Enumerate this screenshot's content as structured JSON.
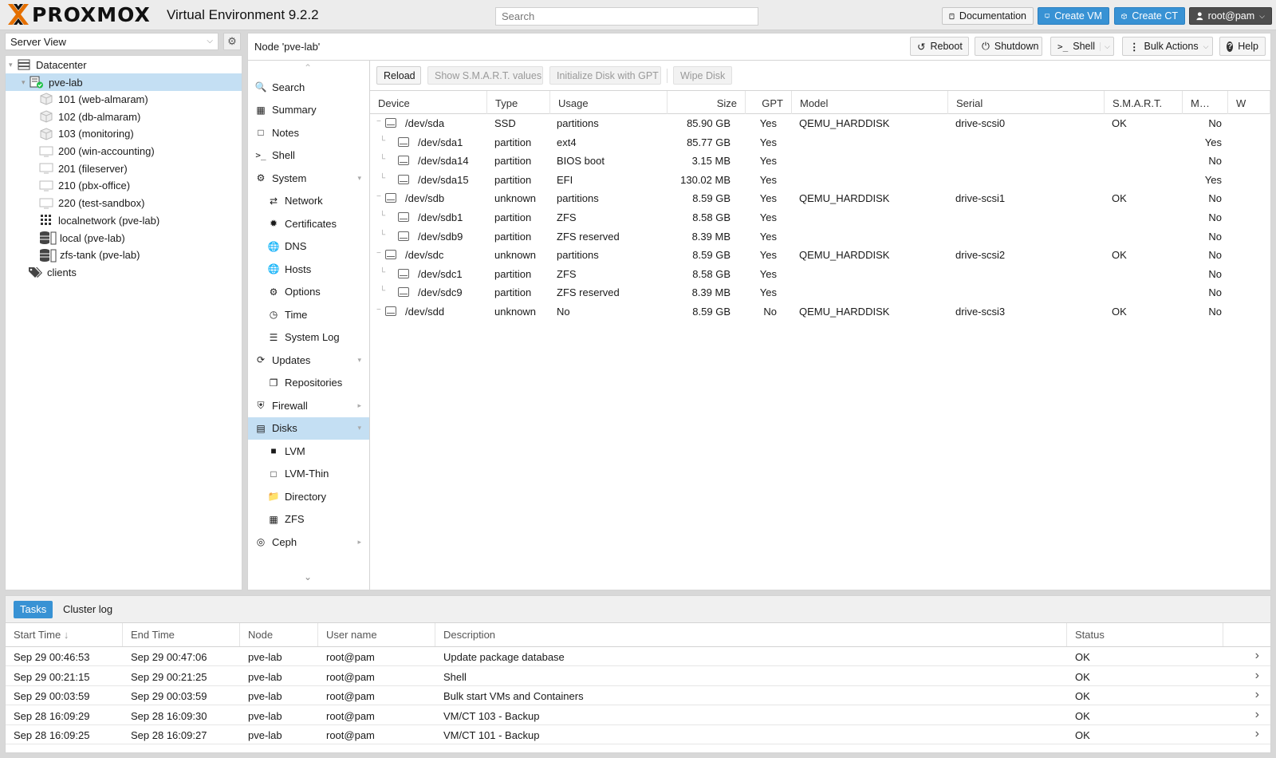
{
  "header": {
    "logo_text": "PROXMOX",
    "product": "Virtual Environment 9.2.2",
    "search_placeholder": "Search",
    "buttons": {
      "documentation": "Documentation",
      "create_vm": "Create VM",
      "create_ct": "Create CT",
      "user": "root@pam"
    }
  },
  "left": {
    "view": "Server View",
    "tree": [
      {
        "label": "Datacenter",
        "icon": "datacenter-icon"
      },
      {
        "label": "pve-lab",
        "icon": "node-online-icon"
      },
      {
        "label": "101 (web-almaram)",
        "icon": "container-icon"
      },
      {
        "label": "102 (db-almaram)",
        "icon": "container-icon"
      },
      {
        "label": "103 (monitoring)",
        "icon": "container-icon"
      },
      {
        "label": "200 (win-accounting)",
        "icon": "vm-icon"
      },
      {
        "label": "201 (fileserver)",
        "icon": "vm-icon"
      },
      {
        "label": "210 (pbx-office)",
        "icon": "vm-icon"
      },
      {
        "label": "220 (test-sandbox)",
        "icon": "vm-icon"
      },
      {
        "label": "localnetwork (pve-lab)",
        "icon": "network-grid-icon"
      },
      {
        "label": "local (pve-lab)",
        "icon": "storage-icon"
      },
      {
        "label": "zfs-tank (pve-lab)",
        "icon": "storage-icon"
      },
      {
        "label": "clients",
        "icon": "tags-icon"
      }
    ]
  },
  "node": {
    "title": "Node 'pve-lab'",
    "buttons": {
      "reboot": "Reboot",
      "shutdown": "Shutdown",
      "shell": "Shell",
      "bulk": "Bulk Actions",
      "help": "Help"
    }
  },
  "nav": [
    {
      "label": "Search",
      "icon": "search-icon"
    },
    {
      "label": "Summary",
      "icon": "book-icon"
    },
    {
      "label": "Notes",
      "icon": "note-icon"
    },
    {
      "label": "Shell",
      "icon": "terminal-icon"
    },
    {
      "label": "System",
      "icon": "cogs-icon"
    },
    {
      "label": "Network",
      "icon": "exchange-icon"
    },
    {
      "label": "Certificates",
      "icon": "certificate-icon"
    },
    {
      "label": "DNS",
      "icon": "globe-icon"
    },
    {
      "label": "Hosts",
      "icon": "globe-icon"
    },
    {
      "label": "Options",
      "icon": "gear-icon"
    },
    {
      "label": "Time",
      "icon": "clock-icon"
    },
    {
      "label": "System Log",
      "icon": "list-icon"
    },
    {
      "label": "Updates",
      "icon": "refresh-icon"
    },
    {
      "label": "Repositories",
      "icon": "files-icon"
    },
    {
      "label": "Firewall",
      "icon": "shield-icon"
    },
    {
      "label": "Disks",
      "icon": "hdd-icon"
    },
    {
      "label": "LVM",
      "icon": "square-icon"
    },
    {
      "label": "LVM-Thin",
      "icon": "square-outline-icon"
    },
    {
      "label": "Directory",
      "icon": "folder-icon"
    },
    {
      "label": "ZFS",
      "icon": "th-large-icon"
    },
    {
      "label": "Ceph",
      "icon": "ceph-icon"
    }
  ],
  "disks": {
    "toolbar": {
      "reload": "Reload",
      "smart": "Show S.M.A.R.T. values",
      "init_gpt": "Initialize Disk with GPT",
      "wipe": "Wipe Disk"
    },
    "columns": [
      "Device",
      "Type",
      "Usage",
      "Size",
      "GPT",
      "Model",
      "Serial",
      "S.M.A.R.T.",
      "M…",
      "W"
    ],
    "rows": [
      {
        "device": "/dev/sda",
        "type": "SSD",
        "usage": "partitions",
        "size": "85.90 GB",
        "gpt": "Yes",
        "model": "QEMU_HARDDISK",
        "serial": "drive-scsi0",
        "smart": "OK",
        "mounted": "No",
        "child": false
      },
      {
        "device": "/dev/sda1",
        "type": "partition",
        "usage": "ext4",
        "size": "85.77 GB",
        "gpt": "Yes",
        "model": "",
        "serial": "",
        "smart": "",
        "mounted": "Yes",
        "child": true
      },
      {
        "device": "/dev/sda14",
        "type": "partition",
        "usage": "BIOS boot",
        "size": "3.15 MB",
        "gpt": "Yes",
        "model": "",
        "serial": "",
        "smart": "",
        "mounted": "No",
        "child": true
      },
      {
        "device": "/dev/sda15",
        "type": "partition",
        "usage": "EFI",
        "size": "130.02 MB",
        "gpt": "Yes",
        "model": "",
        "serial": "",
        "smart": "",
        "mounted": "Yes",
        "child": true
      },
      {
        "device": "/dev/sdb",
        "type": "unknown",
        "usage": "partitions",
        "size": "8.59 GB",
        "gpt": "Yes",
        "model": "QEMU_HARDDISK",
        "serial": "drive-scsi1",
        "smart": "OK",
        "mounted": "No",
        "child": false
      },
      {
        "device": "/dev/sdb1",
        "type": "partition",
        "usage": "ZFS",
        "size": "8.58 GB",
        "gpt": "Yes",
        "model": "",
        "serial": "",
        "smart": "",
        "mounted": "No",
        "child": true
      },
      {
        "device": "/dev/sdb9",
        "type": "partition",
        "usage": "ZFS reserved",
        "size": "8.39 MB",
        "gpt": "Yes",
        "model": "",
        "serial": "",
        "smart": "",
        "mounted": "No",
        "child": true
      },
      {
        "device": "/dev/sdc",
        "type": "unknown",
        "usage": "partitions",
        "size": "8.59 GB",
        "gpt": "Yes",
        "model": "QEMU_HARDDISK",
        "serial": "drive-scsi2",
        "smart": "OK",
        "mounted": "No",
        "child": false
      },
      {
        "device": "/dev/sdc1",
        "type": "partition",
        "usage": "ZFS",
        "size": "8.58 GB",
        "gpt": "Yes",
        "model": "",
        "serial": "",
        "smart": "",
        "mounted": "No",
        "child": true
      },
      {
        "device": "/dev/sdc9",
        "type": "partition",
        "usage": "ZFS reserved",
        "size": "8.39 MB",
        "gpt": "Yes",
        "model": "",
        "serial": "",
        "smart": "",
        "mounted": "No",
        "child": true
      },
      {
        "device": "/dev/sdd",
        "type": "unknown",
        "usage": "No",
        "size": "8.59 GB",
        "gpt": "No",
        "model": "QEMU_HARDDISK",
        "serial": "drive-scsi3",
        "smart": "OK",
        "mounted": "No",
        "child": false
      }
    ]
  },
  "tasks": {
    "tabs": [
      "Tasks",
      "Cluster log"
    ],
    "columns": [
      "Start Time",
      "End Time",
      "Node",
      "User name",
      "Description",
      "Status"
    ],
    "rows": [
      {
        "start": "Sep 29 00:46:53",
        "end": "Sep 29 00:47:06",
        "node": "pve-lab",
        "user": "root@pam",
        "desc": "Update package database",
        "status": "OK"
      },
      {
        "start": "Sep 29 00:21:15",
        "end": "Sep 29 00:21:25",
        "node": "pve-lab",
        "user": "root@pam",
        "desc": "Shell",
        "status": "OK"
      },
      {
        "start": "Sep 29 00:03:59",
        "end": "Sep 29 00:03:59",
        "node": "pve-lab",
        "user": "root@pam",
        "desc": "Bulk start VMs and Containers",
        "status": "OK"
      },
      {
        "start": "Sep 28 16:09:29",
        "end": "Sep 28 16:09:30",
        "node": "pve-lab",
        "user": "root@pam",
        "desc": "VM/CT 103 - Backup",
        "status": "OK"
      },
      {
        "start": "Sep 28 16:09:25",
        "end": "Sep 28 16:09:27",
        "node": "pve-lab",
        "user": "root@pam",
        "desc": "VM/CT 101 - Backup",
        "status": "OK"
      }
    ]
  },
  "colors": {
    "accent": "#3892d4",
    "selection": "#c4dff3",
    "logo_orange": "#e57000",
    "online_green": "#21bf4b"
  }
}
